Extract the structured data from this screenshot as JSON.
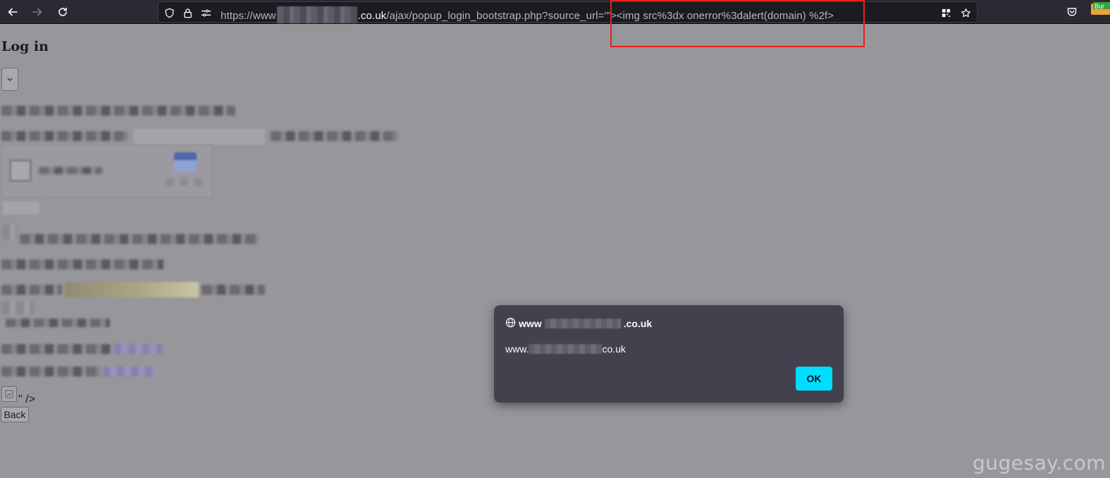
{
  "browser": {
    "url_prefix": "https://www",
    "url_host": ".co.uk",
    "url_path": "/ajax/popup_login_bootstrap.php?source_url=",
    "url_payload": "'\"><img src%3dx onerror%3dalert(domain) %2f>",
    "extension_label": "Bur",
    "icons": [
      "back-arrow-icon",
      "forward-arrow-icon",
      "reload-icon",
      "shield-icon",
      "lock-icon",
      "permissions-icon",
      "qr-code-icon",
      "bookmark-star-icon",
      "pocket-icon",
      "burp-extension-icon"
    ]
  },
  "page": {
    "heading": "Log in",
    "ending_text": "\" />",
    "back_label": "Back"
  },
  "dialog": {
    "title_prefix": "www",
    "title_suffix": ".co.uk",
    "message_prefix": "www.",
    "message_suffix": "co.uk",
    "ok_label": "OK"
  },
  "watermark": "gugesay.com",
  "colors": {
    "toolbar_bg": "#2b2a33",
    "page_overlay": "#97969b",
    "dialog_bg": "#42414d",
    "ok_button": "#00ddff",
    "highlight_box": "#e8201c"
  }
}
